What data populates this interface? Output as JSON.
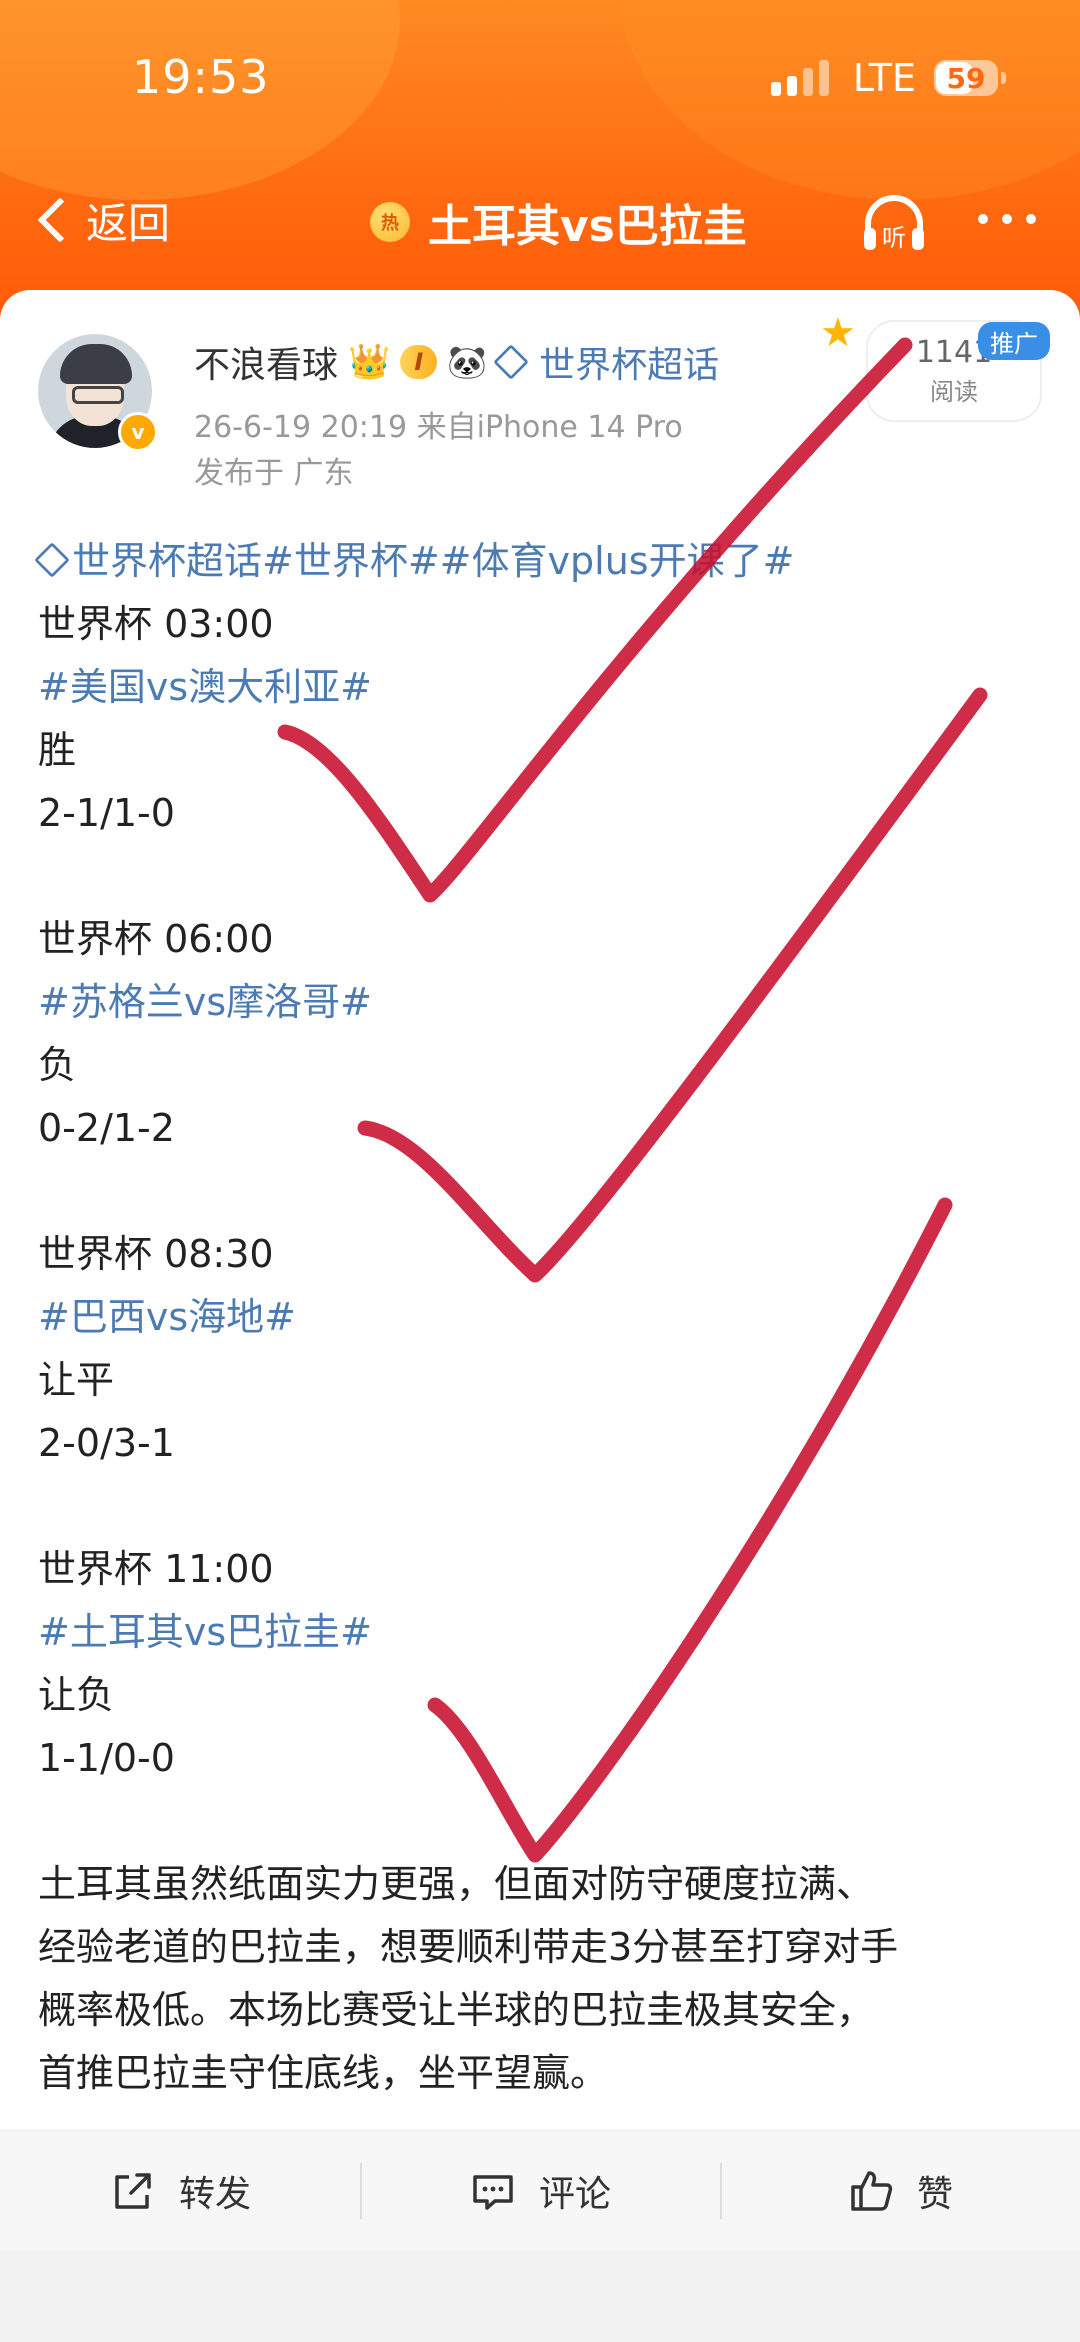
{
  "status_bar": {
    "time": "19:53",
    "network": "LTE",
    "battery": "59"
  },
  "nav": {
    "back_label": "返回",
    "hot_icon_text": "热",
    "title": "土耳其vs巴拉圭",
    "listen_label": "听"
  },
  "author": {
    "name": "不浪看球",
    "level": "I",
    "topic_link": "世界杯超话",
    "time_source": "26-6-19 20:19  来自iPhone 14 Pro",
    "location": "发布于 广东",
    "reads_count": "1141",
    "reads_label": "阅读",
    "promo_label": "推广"
  },
  "post": {
    "topics_line": "世界杯超话#世界杯##体育vplus开课了#",
    "matches": [
      {
        "header": "世界杯 03:00",
        "match": "#美国vs澳大利亚#",
        "pick": "胜",
        "score": "2-1/1-0"
      },
      {
        "header": "世界杯 06:00",
        "match": "#苏格兰vs摩洛哥#",
        "pick": "负",
        "score": "0-2/1-2"
      },
      {
        "header": "世界杯 08:30",
        "match": "#巴西vs海地#",
        "pick": "让平",
        "score": "2-0/3-1"
      },
      {
        "header": "世界杯 11:00",
        "match": "#土耳其vs巴拉圭#",
        "pick": "让负",
        "score": "1-1/0-0"
      }
    ],
    "analysis_lines": [
      "土耳其虽然纸面实力更强，但面对防守硬度拉满、",
      "经验老道的巴拉圭，想要顺利带走3分甚至打穿对手",
      "概率极低。本场比赛受让半球的巴拉圭极其安全，",
      "首推巴拉圭守住底线，坐平望赢。"
    ]
  },
  "actions": {
    "repost": "转发",
    "comment": "评论",
    "like": "赞"
  },
  "colors": {
    "header": "#ff6a10",
    "link": "#4c7bb3",
    "check_mark": "#c8102e"
  }
}
